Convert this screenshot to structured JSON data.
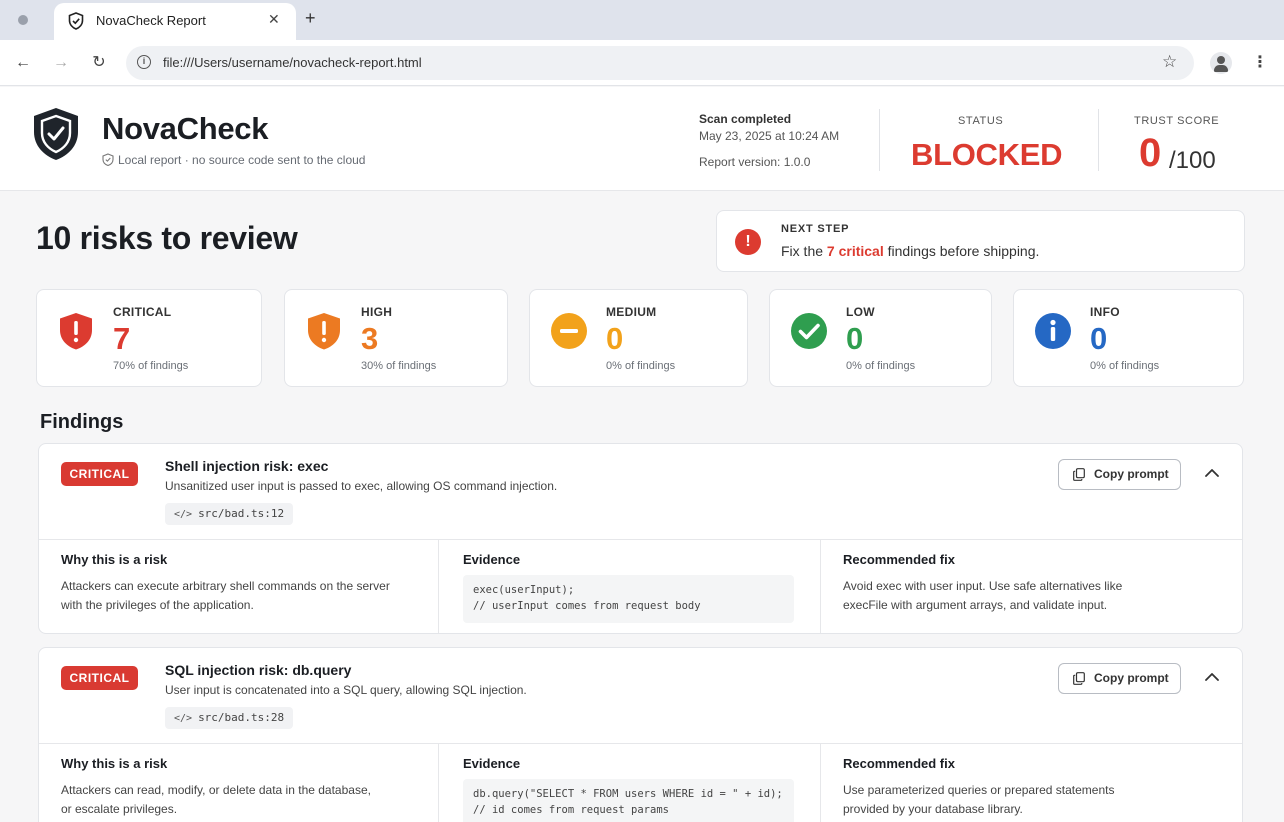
{
  "browser": {
    "tab_title": "NovaCheck Report",
    "tab_close": "✕",
    "new_tab": "+",
    "url": "file:///Users/username/novacheck-report.html"
  },
  "header": {
    "brand": "NovaCheck",
    "local_note": "Local report · no source code sent to the cloud",
    "scan_title": "Scan completed",
    "scan_date": "May 23, 2025 at 10:24 AM",
    "report_version": "Report version: 1.0.0",
    "status_label": "STATUS",
    "status_value": "BLOCKED",
    "trust_label": "TRUST  SCORE",
    "trust_score": "0",
    "trust_total": "/100"
  },
  "summary": {
    "title": "10 risks to review",
    "next_step_label": "NEXT STEP",
    "next_step_prefix": "Fix the ",
    "next_step_highlight": "7 critical",
    "next_step_suffix": " findings before shipping."
  },
  "severities": [
    {
      "label": "CRITICAL",
      "count": "7",
      "pct": "70% of findings",
      "color": "#dc3b30",
      "icon": "shield-alert-icon"
    },
    {
      "label": "HIGH",
      "count": "3",
      "pct": "30% of findings",
      "color": "#ec7a22",
      "icon": "shield-alert-icon"
    },
    {
      "label": "MEDIUM",
      "count": "0",
      "pct": "0% of findings",
      "color": "#f2a21b",
      "icon": "minus-circle-icon"
    },
    {
      "label": "LOW",
      "count": "0",
      "pct": "0% of findings",
      "color": "#2f9e4f",
      "icon": "check-circle-icon"
    },
    {
      "label": "INFO",
      "count": "0",
      "pct": "0% of findings",
      "color": "#2568c4",
      "icon": "info-circle-icon"
    }
  ],
  "findings_title": "Findings",
  "findings": [
    {
      "severity": "CRITICAL",
      "title": "Shell injection risk: exec",
      "description": "Unsanitized user input is passed to exec, allowing OS command injection.",
      "location": "src/bad.ts:12",
      "copy_label": "Copy prompt",
      "why_head": "Why this is a risk",
      "why_text": "Attackers can execute arbitrary shell commands on the server\nwith the privileges of the application.",
      "evidence_head": "Evidence",
      "evidence": "exec(userInput);\n// userInput comes from request body",
      "fix_head": "Recommended fix",
      "fix_text": "Avoid exec with user input. Use safe alternatives like\nexecFile with argument arrays, and validate input."
    },
    {
      "severity": "CRITICAL",
      "title": "SQL injection risk: db.query",
      "description": "User input is concatenated into a SQL query, allowing SQL injection.",
      "location": "src/bad.ts:28",
      "copy_label": "Copy prompt",
      "why_head": "Why this is a risk",
      "why_text": "Attackers can read, modify, or delete data in the database,\nor escalate privileges.",
      "evidence_head": "Evidence",
      "evidence": "db.query(\"SELECT * FROM users WHERE id = \" + id);\n// id comes from request params",
      "fix_head": "Recommended fix",
      "fix_text": "Use parameterized queries or prepared statements\nprovided by your database library."
    }
  ]
}
